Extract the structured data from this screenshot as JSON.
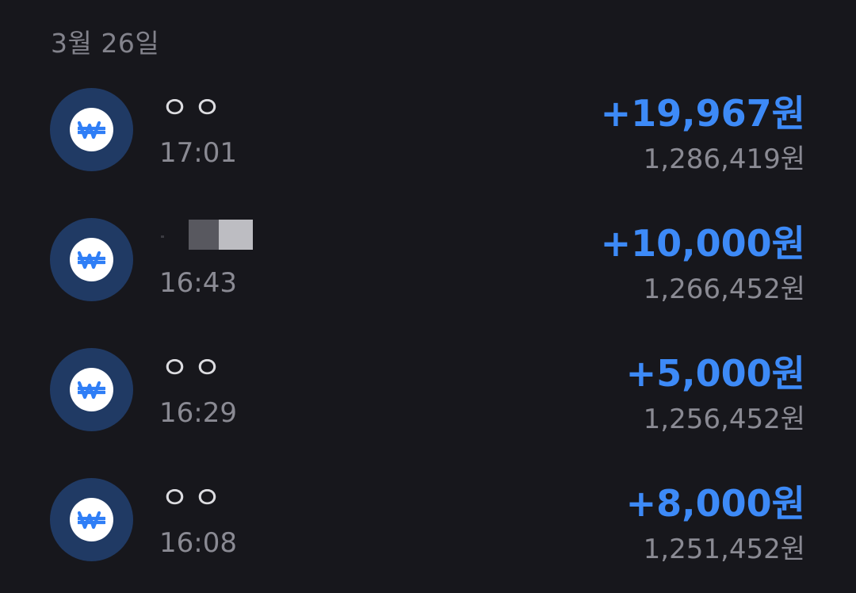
{
  "date_header": "3월 26일",
  "icon": "won-coin-icon",
  "colors": {
    "background": "#17171c",
    "amount_positive": "#3d8af7",
    "icon_ring": "#203a64",
    "secondary_text": "#8a8a93"
  },
  "transactions": [
    {
      "name": "ㅇㅇ",
      "time": "17:01",
      "amount": "+19,967원",
      "balance": "1,286,419원"
    },
    {
      "name": "",
      "time": "16:43",
      "amount": "+10,000원",
      "balance": "1,266,452원"
    },
    {
      "name": "ㅇㅇ",
      "time": "16:29",
      "amount": "+5,000원",
      "balance": "1,256,452원"
    },
    {
      "name": "ㅇㅇ",
      "time": "16:08",
      "amount": "+8,000원",
      "balance": "1,251,452원"
    }
  ]
}
